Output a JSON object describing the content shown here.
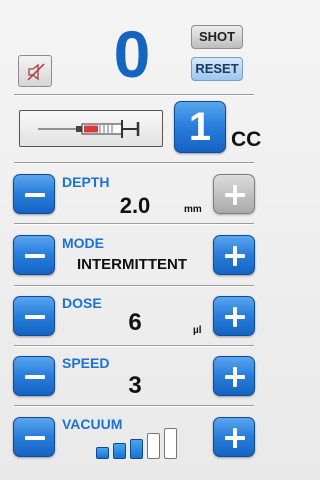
{
  "header": {
    "shot_count": "0",
    "shot_label": "SHOT",
    "reset_label": "RESET",
    "sound_icon": "speaker-muted-icon"
  },
  "syringe": {
    "icon": "syringe-icon",
    "size_value": "1",
    "size_unit": "CC"
  },
  "controls": [
    {
      "label": "DEPTH",
      "value": "2.0",
      "unit": "mm",
      "plus_enabled": false
    },
    {
      "label": "MODE",
      "value": "INTERMITTENT",
      "unit": ""
    },
    {
      "label": "DOSE",
      "value": "6",
      "unit": "µl"
    },
    {
      "label": "SPEED",
      "value": "3",
      "unit": ""
    },
    {
      "label": "VACUUM",
      "value": "",
      "unit": "",
      "level": 3,
      "level_max": 5
    }
  ],
  "colors": {
    "accent": "#1a73d4",
    "counter": "#1565c0"
  }
}
